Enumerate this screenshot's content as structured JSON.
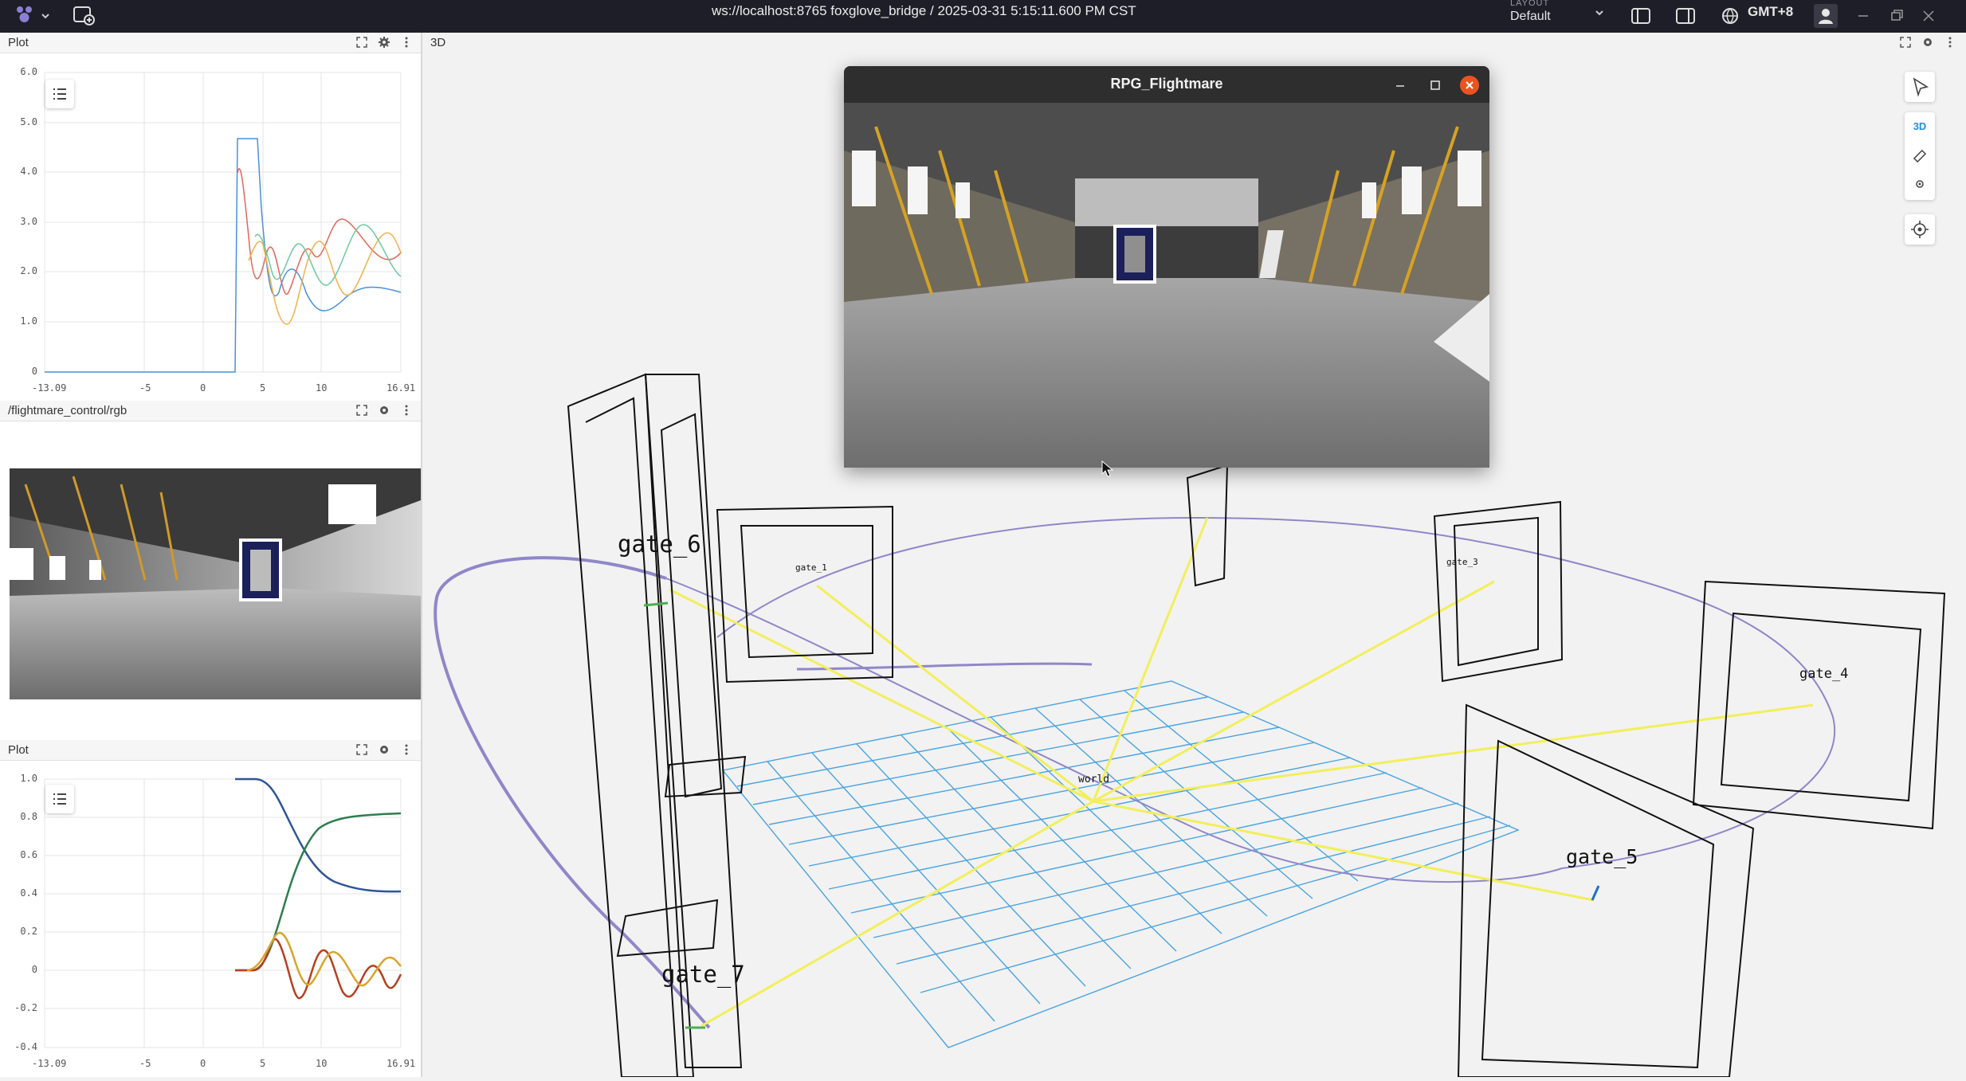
{
  "app": {
    "connection_title": "ws://localhost:8765 foxglove_bridge / 2025-03-31 5:15:11.600 PM CST",
    "layout_caption": "LAYOUT",
    "layout_value": "Default",
    "timezone": "GMT+8"
  },
  "panels": {
    "plot_top": {
      "title": "Plot",
      "y_ticks": [
        "6.0",
        "5.0",
        "4.0",
        "3.0",
        "2.0",
        "1.0",
        "0"
      ],
      "x_ticks": [
        "-13.09",
        "-5",
        "0",
        "5",
        "10",
        "16.91"
      ]
    },
    "image": {
      "title": "/flightmare_control/rgb"
    },
    "plot_bottom": {
      "title": "Plot",
      "y_ticks": [
        "1.0",
        "0.8",
        "0.6",
        "0.4",
        "0.2",
        "0",
        "-0.2",
        "-0.4"
      ],
      "x_ticks": [
        "-13.09",
        "-5",
        "0",
        "5",
        "10",
        "16.91"
      ]
    },
    "viewport": {
      "title": "3D",
      "mode_label": "3D"
    }
  },
  "window": {
    "title": "RPG_Flightmare"
  },
  "scene": {
    "gate_labels": {
      "gate_6": "gate_6",
      "gate_7": "gate_7",
      "gate_5": "gate_5",
      "gate_4": "gate_4",
      "gate_1": "gate_1",
      "gate_3": "gate_3",
      "origin": "world"
    }
  },
  "icons": {
    "logo": "foxglove-logo-icon",
    "add_panel": "add-panel-icon",
    "left_sidebar": "left-sidebar-icon",
    "right_sidebar": "right-sidebar-icon",
    "user": "user-icon",
    "fullscreen": "fullscreen-icon",
    "settings": "gear-icon",
    "menu": "kebab-menu-icon",
    "legend": "legend-list-icon"
  },
  "colors": {
    "topbar": "#1e1e28",
    "trajectory": "#8f87c8",
    "ray": "#f2ef5a",
    "grid": "#4aa3df"
  }
}
